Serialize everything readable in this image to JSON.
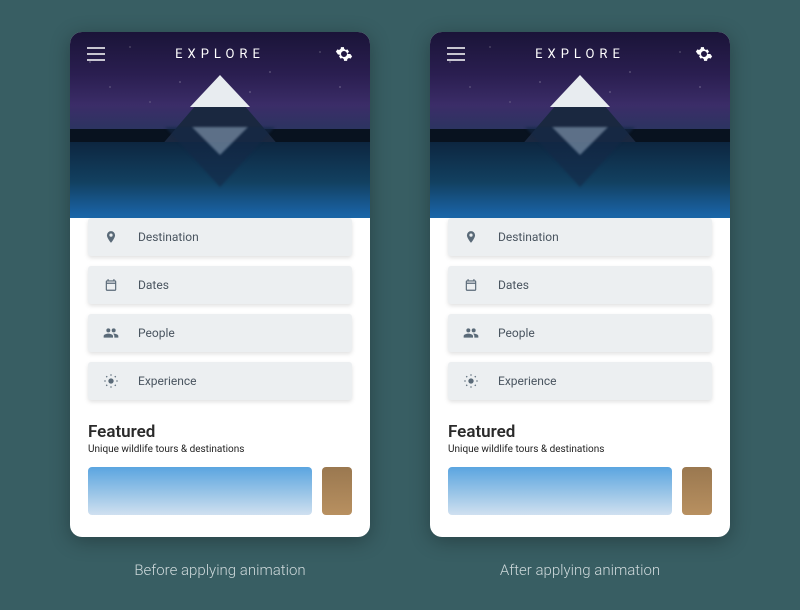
{
  "header": {
    "title": "EXPLORE"
  },
  "filters": [
    {
      "icon": "pin",
      "label": "Destination"
    },
    {
      "icon": "calendar",
      "label": "Dates"
    },
    {
      "icon": "people",
      "label": "People"
    },
    {
      "icon": "sun",
      "label": "Experience"
    }
  ],
  "featured": {
    "title": "Featured",
    "subtitle": "Unique wildlife tours & destinations"
  },
  "captions": {
    "left": "Before applying animation",
    "right": "After applying animation"
  }
}
